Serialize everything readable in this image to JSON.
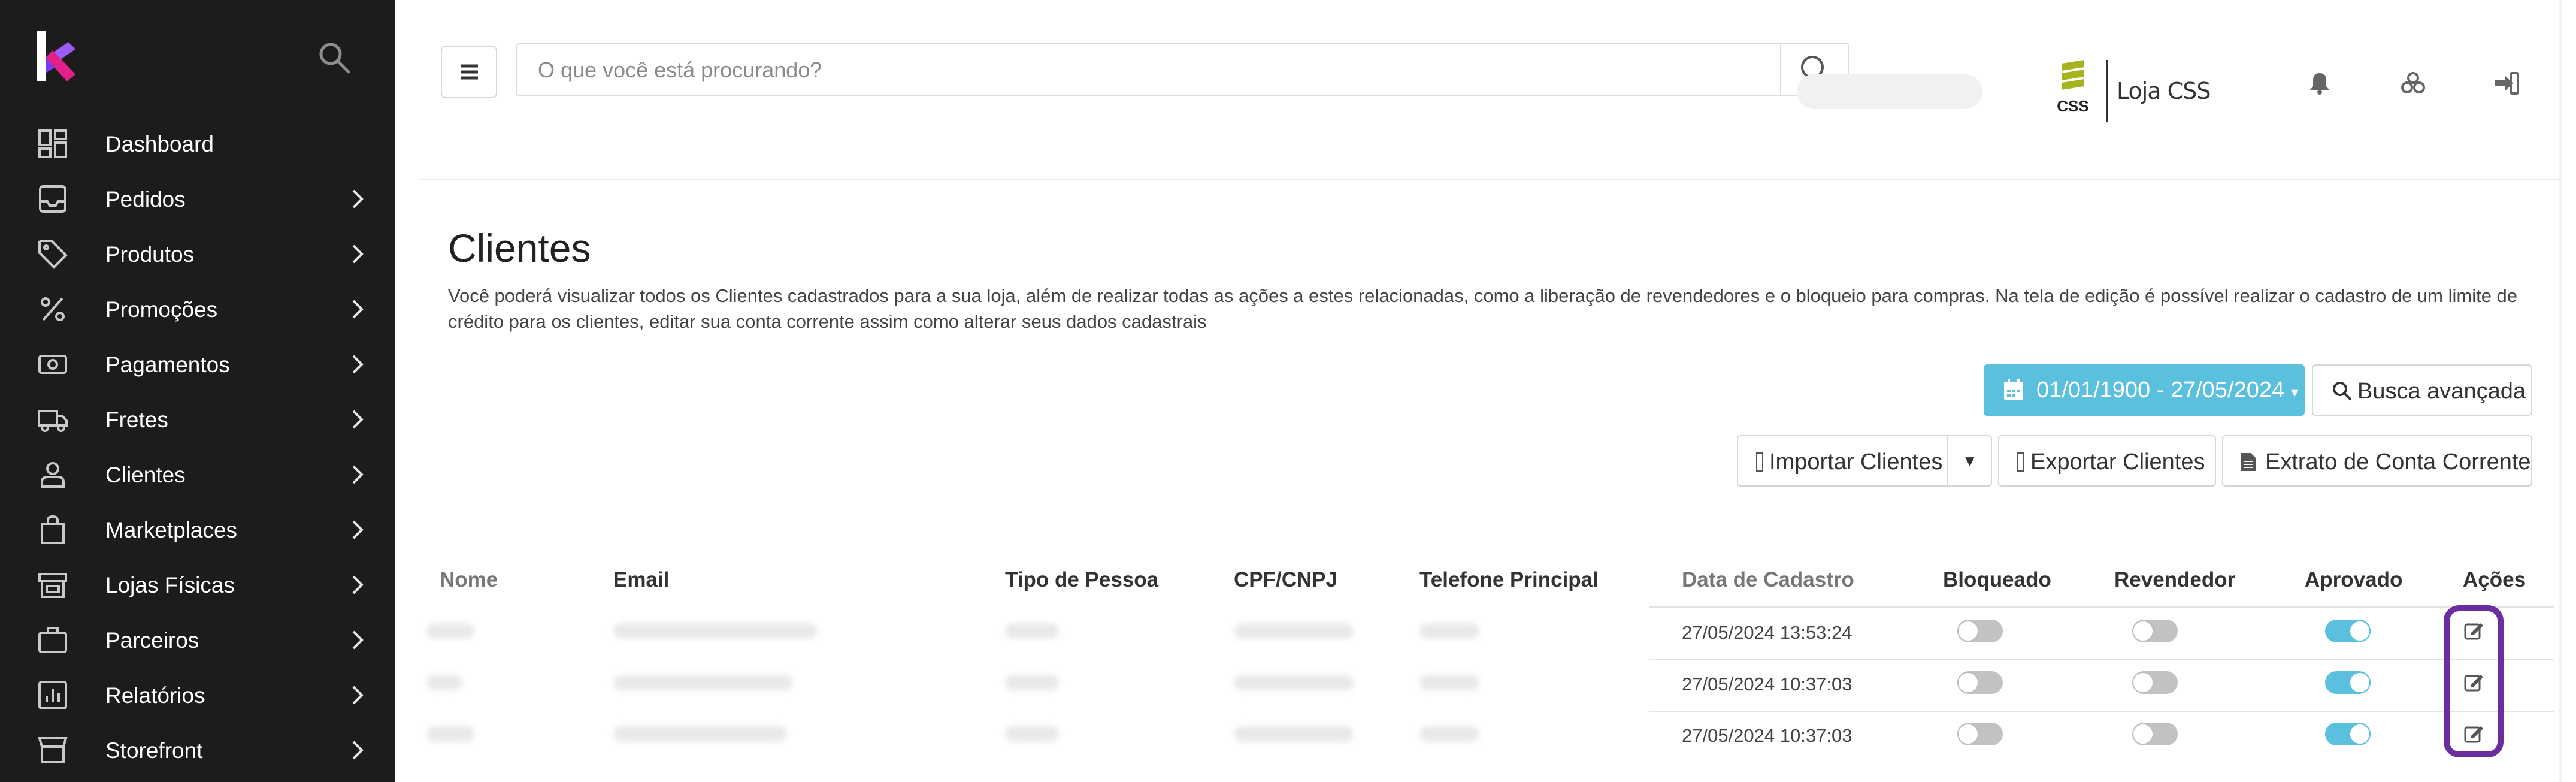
{
  "sidebar": {
    "items": [
      {
        "label": "Dashboard",
        "icon": "dashboard-icon",
        "has_submenu": false
      },
      {
        "label": "Pedidos",
        "icon": "inbox-icon",
        "has_submenu": true
      },
      {
        "label": "Produtos",
        "icon": "tag-icon",
        "has_submenu": true
      },
      {
        "label": "Promoções",
        "icon": "percent-icon",
        "has_submenu": true
      },
      {
        "label": "Pagamentos",
        "icon": "money-icon",
        "has_submenu": true
      },
      {
        "label": "Fretes",
        "icon": "truck-icon",
        "has_submenu": true
      },
      {
        "label": "Clientes",
        "icon": "user-icon",
        "has_submenu": true
      },
      {
        "label": "Marketplaces",
        "icon": "shopping-bag-icon",
        "has_submenu": true
      },
      {
        "label": "Lojas Físicas",
        "icon": "store-icon",
        "has_submenu": true
      },
      {
        "label": "Parceiros",
        "icon": "briefcase-icon",
        "has_submenu": true
      },
      {
        "label": "Relatórios",
        "icon": "report-icon",
        "has_submenu": true
      },
      {
        "label": "Storefront",
        "icon": "storefront-icon",
        "has_submenu": true
      }
    ]
  },
  "header": {
    "search_placeholder": "O que você está procurando?",
    "store_badge": "CSS",
    "store_name": "Loja CSS"
  },
  "page": {
    "title": "Clientes",
    "description": "Você poderá visualizar todos os Clientes cadastrados para a sua loja, além de realizar todas as ações a estes relacionadas, como a liberação de revendedores e o bloqueio para compras. Na tela de edição é possível realizar o cadastro de um limite de crédito para os clientes, editar sua conta corrente assim como alterar seus dados cadastrais"
  },
  "filters": {
    "date_range": "01/01/1900 - 27/05/2024",
    "advanced_search": "Busca avançada"
  },
  "actions": {
    "import": "Importar Clientes",
    "export": "Exportar Clientes",
    "statement": "Extrato de Conta Corrente"
  },
  "table": {
    "columns": [
      "Nome",
      "Email",
      "Tipo de Pessoa",
      "CPF/CNPJ",
      "Telefone Principal",
      "Data de Cadastro",
      "Bloqueado",
      "Revendedor",
      "Aprovado",
      "Ações"
    ],
    "rows": [
      {
        "created": "27/05/2024 13:53:24",
        "blocked": false,
        "reseller": false,
        "approved": true
      },
      {
        "created": "27/05/2024 10:37:03",
        "blocked": false,
        "reseller": false,
        "approved": true
      },
      {
        "created": "27/05/2024 10:37:03",
        "blocked": false,
        "reseller": false,
        "approved": true
      }
    ]
  },
  "colors": {
    "sidebar_bg": "#1c1c1c",
    "accent": "#5bc0de",
    "highlight": "#6a2ea0",
    "brand_magenta": "#e0218a",
    "brand_green": "#a8b320"
  }
}
